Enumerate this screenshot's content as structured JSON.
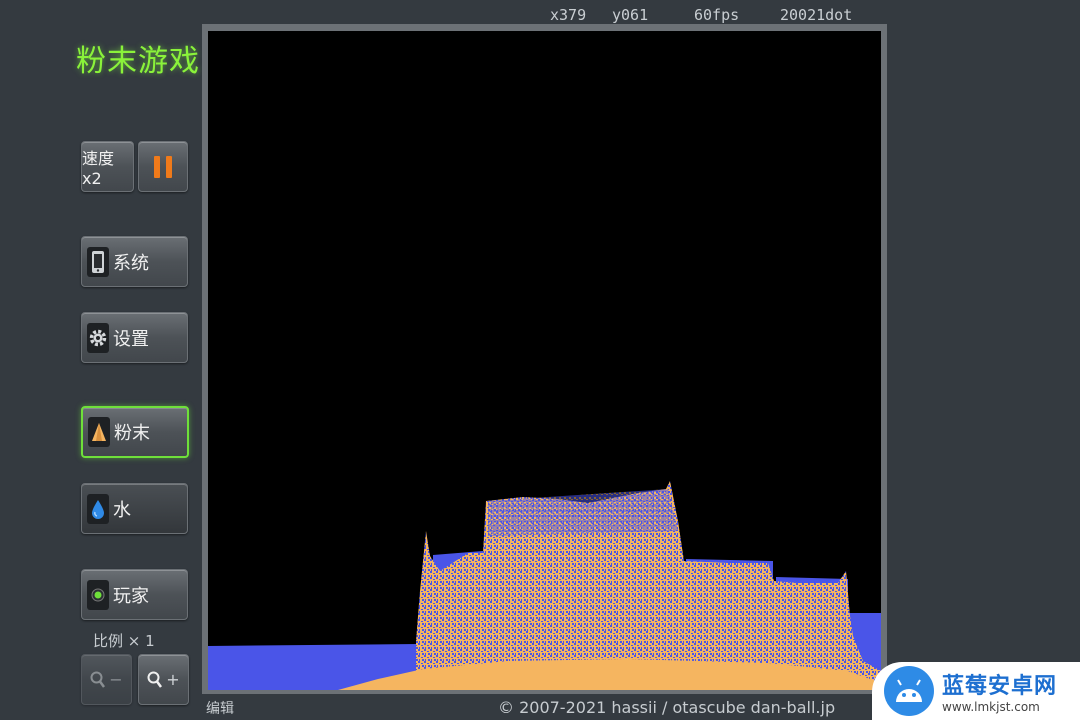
{
  "app": {
    "title": "粉末游戏"
  },
  "stats": {
    "x": "x379",
    "y": "y061",
    "fps": "60fps",
    "dot": "20021dot"
  },
  "controls": {
    "speed_label": "速度x2",
    "pause_icon": "pause-icon",
    "system_label": "系统",
    "settings_label": "设置",
    "powder_label": "粉末",
    "water_label": "水",
    "player_label": "玩家",
    "scale_label": "比例 × 1",
    "zoom_out_label": "−",
    "zoom_in_label": "+"
  },
  "footer": {
    "edit_label": "编辑",
    "copyright": "© 2007-2021 hassii / otascube dan-ball.jp"
  },
  "watermark": {
    "name": "蓝莓安卓网",
    "url": "www.lmkjst.com"
  },
  "colors": {
    "title": "#8af23a",
    "powder": "#f5b560",
    "water": "#4a55e8",
    "pause": "#f07a1a",
    "active_border": "#6fe03a"
  }
}
